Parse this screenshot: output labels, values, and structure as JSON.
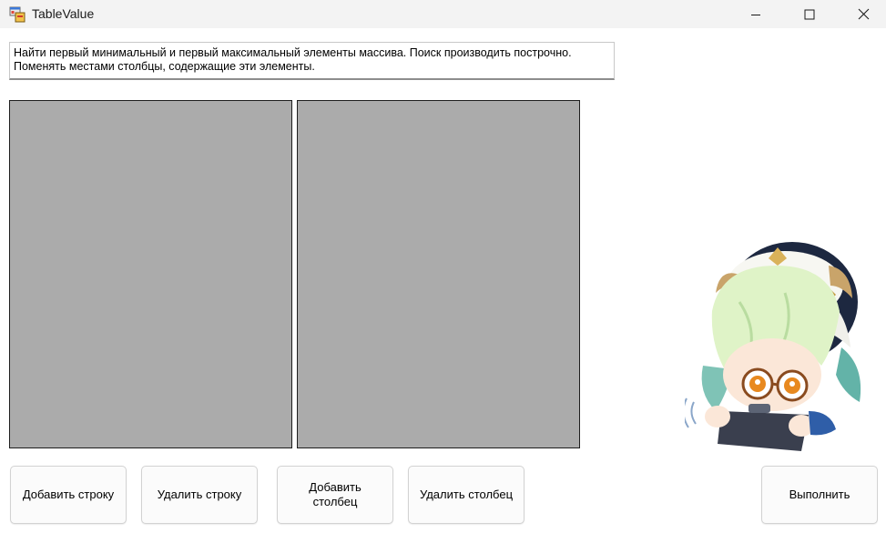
{
  "window": {
    "title": "TableValue",
    "app_icon": "windows-forms-app-icon",
    "controls": {
      "minimize_icon": "minimize-icon",
      "maximize_icon": "maximize-icon",
      "close_icon": "close-icon"
    }
  },
  "task": {
    "text": "Найти первый минимальный и первый максимальный элементы массива. Поиск производить построчно. Поменять местами столбцы, содержащие эти элементы."
  },
  "grids": {
    "left": {
      "rows": []
    },
    "right": {
      "rows": []
    }
  },
  "buttons": {
    "add_row": "Добавить строку",
    "delete_row": "Удалить строку",
    "add_column": "Добавить столбец",
    "delete_column": "Удалить столбец",
    "execute": "Выполнить"
  },
  "decoration": {
    "mascot": "chibi-character-image"
  },
  "colors": {
    "titlebar": "#f3f3f3",
    "grid_background": "#ababab",
    "grid_border": "#1e1e1e",
    "button_background": "#fbfbfb",
    "button_border": "#d2d2d2"
  }
}
